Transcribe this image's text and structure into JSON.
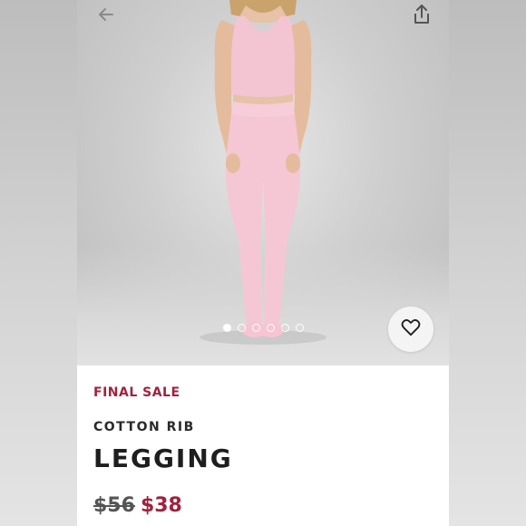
{
  "nav": {
    "back_icon": "arrow-left-icon",
    "share_icon": "share-icon"
  },
  "gallery": {
    "image_alt": "Model wearing pink cotton rib tank and leggings",
    "dots_total": 6,
    "active_index": 0
  },
  "favorite": {
    "icon": "heart-icon"
  },
  "product": {
    "sale_badge": "FINAL SALE",
    "collection": "COTTON RIB",
    "name": "LEGGING",
    "price_original": "$56",
    "price_sale": "$38"
  },
  "colors": {
    "accent": "#a0223e",
    "garment": "#f4c6d3",
    "text_dark": "#1e1e1e"
  }
}
